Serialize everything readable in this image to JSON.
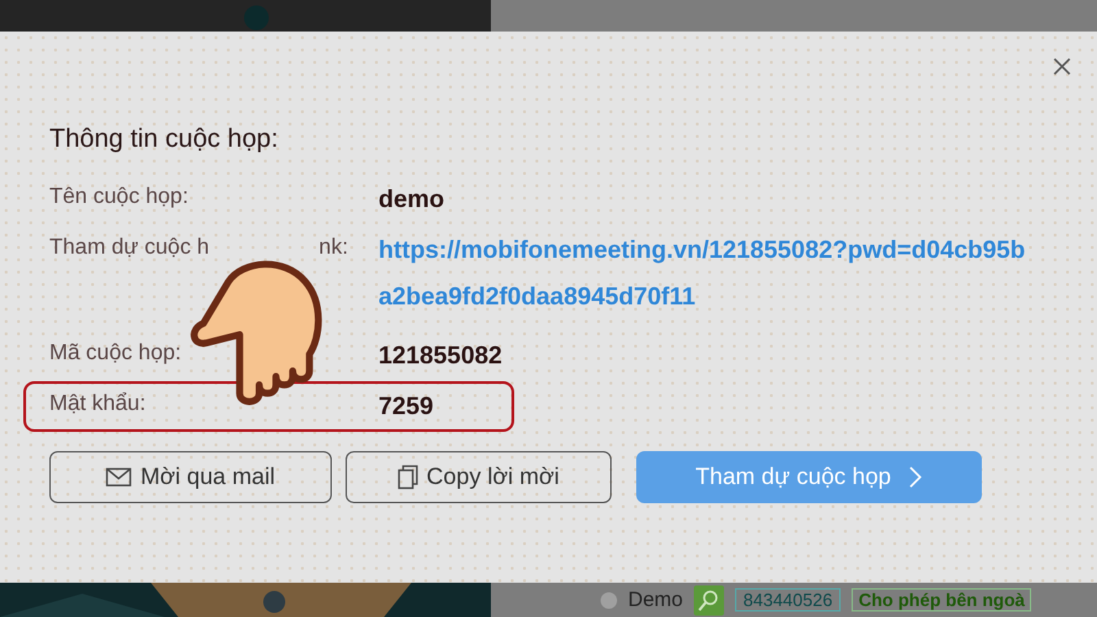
{
  "background_bottom": {
    "selected": false,
    "name": "Demo",
    "code": "843440526",
    "tag": "Cho phép bên ngoà"
  },
  "dialog": {
    "title": "Thông tin cuộc họp:",
    "rows": [
      {
        "kind": "text",
        "label": [
          "Tên cuộc họp:"
        ],
        "value": "demo",
        "highlighted": false
      },
      {
        "kind": "link",
        "label": [
          "Tham dự cuộc h",
          "nk:"
        ],
        "value": "https://mobifonemeeting.vn/121855082?pwd=d04cb95ba2bea9fd2f0daa8945d70f11",
        "highlighted": false
      },
      {
        "kind": "text",
        "label": [
          "Mã cuộc họp:"
        ],
        "value": "121855082",
        "highlighted": false
      },
      {
        "kind": "text",
        "label": [
          "Mật khẩu:"
        ],
        "value": "7259",
        "highlighted": true
      }
    ],
    "buttons": [
      {
        "kind": "mail",
        "label": "Mời qua mail"
      },
      {
        "kind": "copy",
        "label": "Copy lời mời"
      },
      {
        "kind": "primary",
        "label": "Tham dự cuộc họp"
      }
    ]
  }
}
